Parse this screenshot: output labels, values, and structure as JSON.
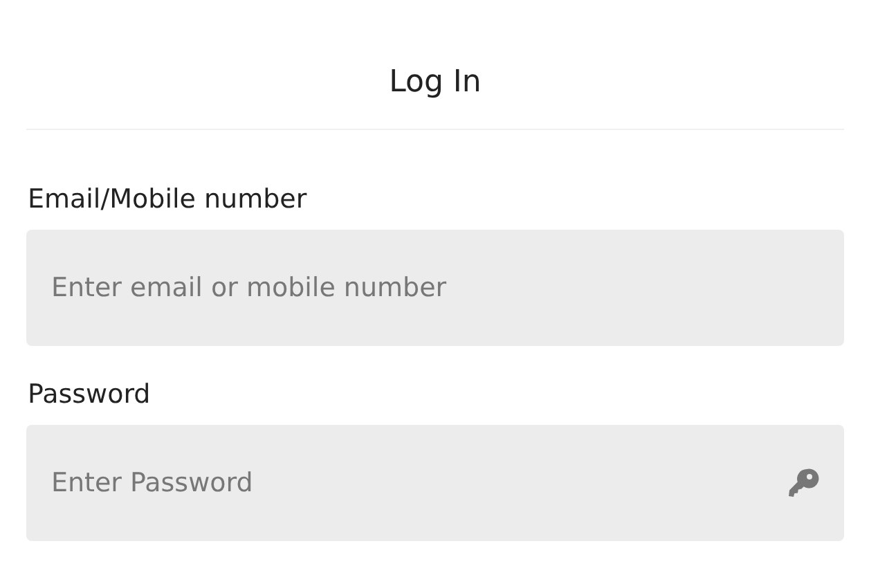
{
  "title": "Log In",
  "fields": [
    {
      "kind": "text",
      "label": "Email/Mobile number",
      "placeholder": "Enter email or mobile number"
    },
    {
      "kind": "password",
      "label": "Password",
      "placeholder": "Enter Password"
    }
  ]
}
